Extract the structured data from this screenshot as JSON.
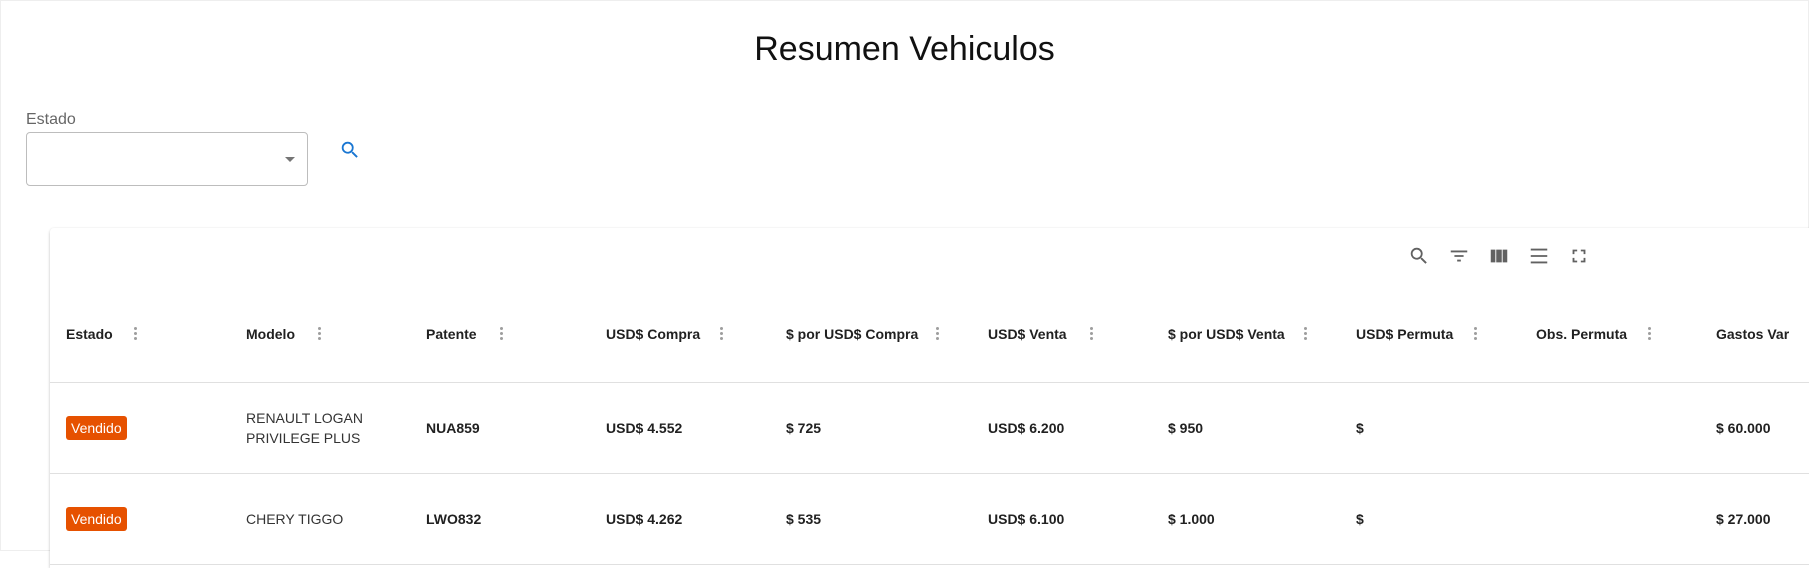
{
  "page": {
    "title": "Resumen Vehiculos"
  },
  "filter": {
    "label": "Estado",
    "value": "",
    "search_icon": "search-icon"
  },
  "toolbar": {
    "icons": [
      "search-icon",
      "filter-list-icon",
      "view-column-icon",
      "density-icon",
      "fullscreen-icon"
    ]
  },
  "table": {
    "columns": [
      "Estado",
      "Modelo",
      "Patente",
      "USD$ Compra",
      "$ por USD$ Compra",
      "USD$ Venta",
      "$ por USD$ Venta",
      "USD$ Permuta",
      "Obs. Permuta",
      "Gastos Var"
    ],
    "rows": [
      {
        "estado": "Vendido",
        "modelo": "RENAULT LOGAN PRIVILEGE PLUS",
        "patente": "NUA859",
        "usd_compra": "USD$ 4.552",
        "pesos_usd_compra": "$ 725",
        "usd_venta": "USD$ 6.200",
        "pesos_usd_venta": "$ 950",
        "usd_permuta": "$",
        "obs_permuta": "",
        "gastos": "$ 60.000"
      },
      {
        "estado": "Vendido",
        "modelo": "CHERY TIGGO",
        "patente": "LWO832",
        "usd_compra": "USD$ 4.262",
        "pesos_usd_compra": "$ 535",
        "usd_venta": "USD$ 6.100",
        "pesos_usd_venta": "$ 1.000",
        "usd_permuta": "$",
        "obs_permuta": "",
        "gastos": "$ 27.000"
      }
    ]
  },
  "colors": {
    "badge": "#e65100",
    "accent": "#1976d2"
  }
}
